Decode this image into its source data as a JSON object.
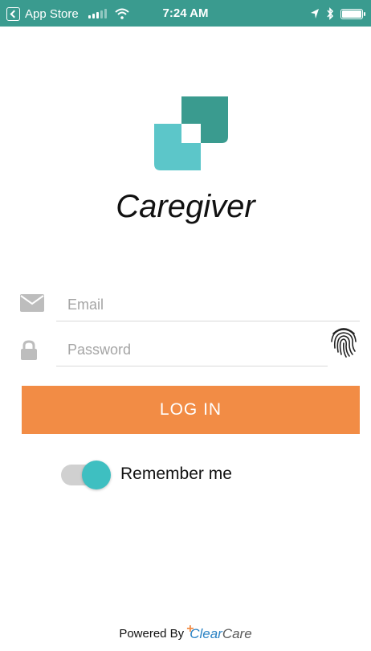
{
  "status_bar": {
    "back_app": "App Store",
    "time": "7:24 AM",
    "background_color": "#3a9b8f"
  },
  "app": {
    "title": "Caregiver",
    "logo_icon": "caregiver-logo-icon",
    "logo_colors": [
      "#3a9b8f",
      "#5cc6c9"
    ]
  },
  "login_form": {
    "email": {
      "placeholder": "Email",
      "value": "",
      "icon": "envelope-icon"
    },
    "password": {
      "placeholder": "Password",
      "value": "",
      "icon": "lock-icon"
    },
    "fingerprint_icon": "fingerprint-icon",
    "login_button_label": "LOG IN",
    "login_button_color": "#f28c45",
    "remember_me": {
      "label": "Remember me",
      "enabled": true,
      "toggle_color": "#3ebfc1"
    }
  },
  "footer": {
    "powered_by": "Powered By",
    "brand_clear": "Clear",
    "brand_care": "Care"
  }
}
